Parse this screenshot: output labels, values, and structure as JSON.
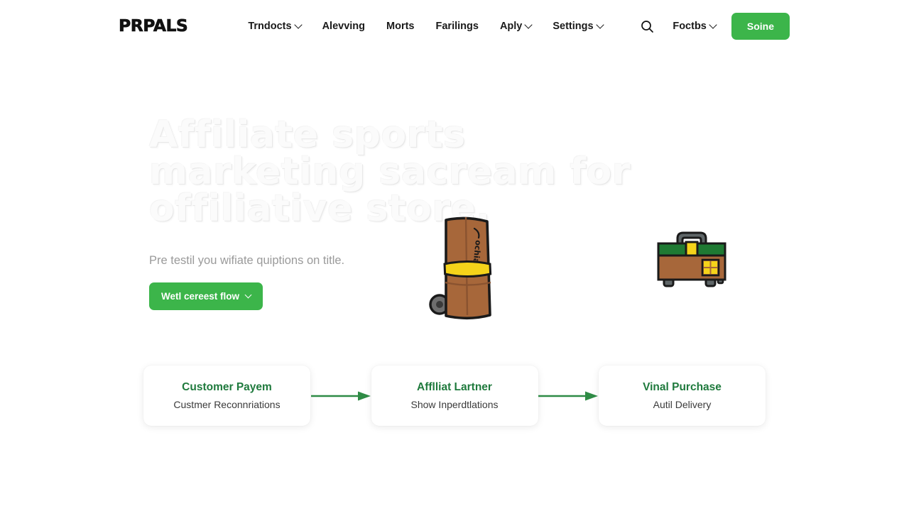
{
  "brand": {
    "logo": "PRPALS"
  },
  "header": {
    "nav": [
      {
        "label": "Trndocts",
        "caret": true,
        "icon": "chevron-down-icon"
      },
      {
        "label": "Alevving",
        "caret": false,
        "icon": ""
      },
      {
        "label": "Morts",
        "caret": false,
        "icon": ""
      },
      {
        "label": "Farilings",
        "caret": false,
        "icon": ""
      },
      {
        "label": "Aply",
        "caret": true,
        "icon": "chevron-down-icon"
      },
      {
        "label": "Settings",
        "caret": true,
        "icon": "chevron-down-icon"
      }
    ],
    "search_icon": "search-icon",
    "account_menu": {
      "label": "Foctbs",
      "icon": "chevron-down-icon"
    },
    "cta": "Soine"
  },
  "hero": {
    "title": "Affiliate sports marketing sacream for offiliative store.",
    "subtitle": "Pre testil you wifiate quiptions on title.",
    "cta": {
      "label": "Wetl cereest flow",
      "icon": "chevron-down-icon"
    }
  },
  "illustrations": {
    "suitcase": {
      "name": "rolling-suitcase-illustration",
      "label": "ochia"
    },
    "toolbox": {
      "name": "toolbox-illustration"
    }
  },
  "flow": {
    "steps": [
      {
        "title": "Customer Payem",
        "subtitle": "Custmer Reconnriations"
      },
      {
        "title": "Afflliat Lartner",
        "subtitle": "Show Inperdtlations"
      },
      {
        "title": "Vinal Purchase",
        "subtitle": "Autil Delivery"
      }
    ],
    "arrow_icon": "arrow-right-icon"
  },
  "colors": {
    "accent_green": "#3cb54a",
    "card_title_green": "#1f7a3d",
    "arrow_green": "#2e8b45",
    "text_dark": "#1a1a1a",
    "text_muted": "#9a9a9a"
  }
}
